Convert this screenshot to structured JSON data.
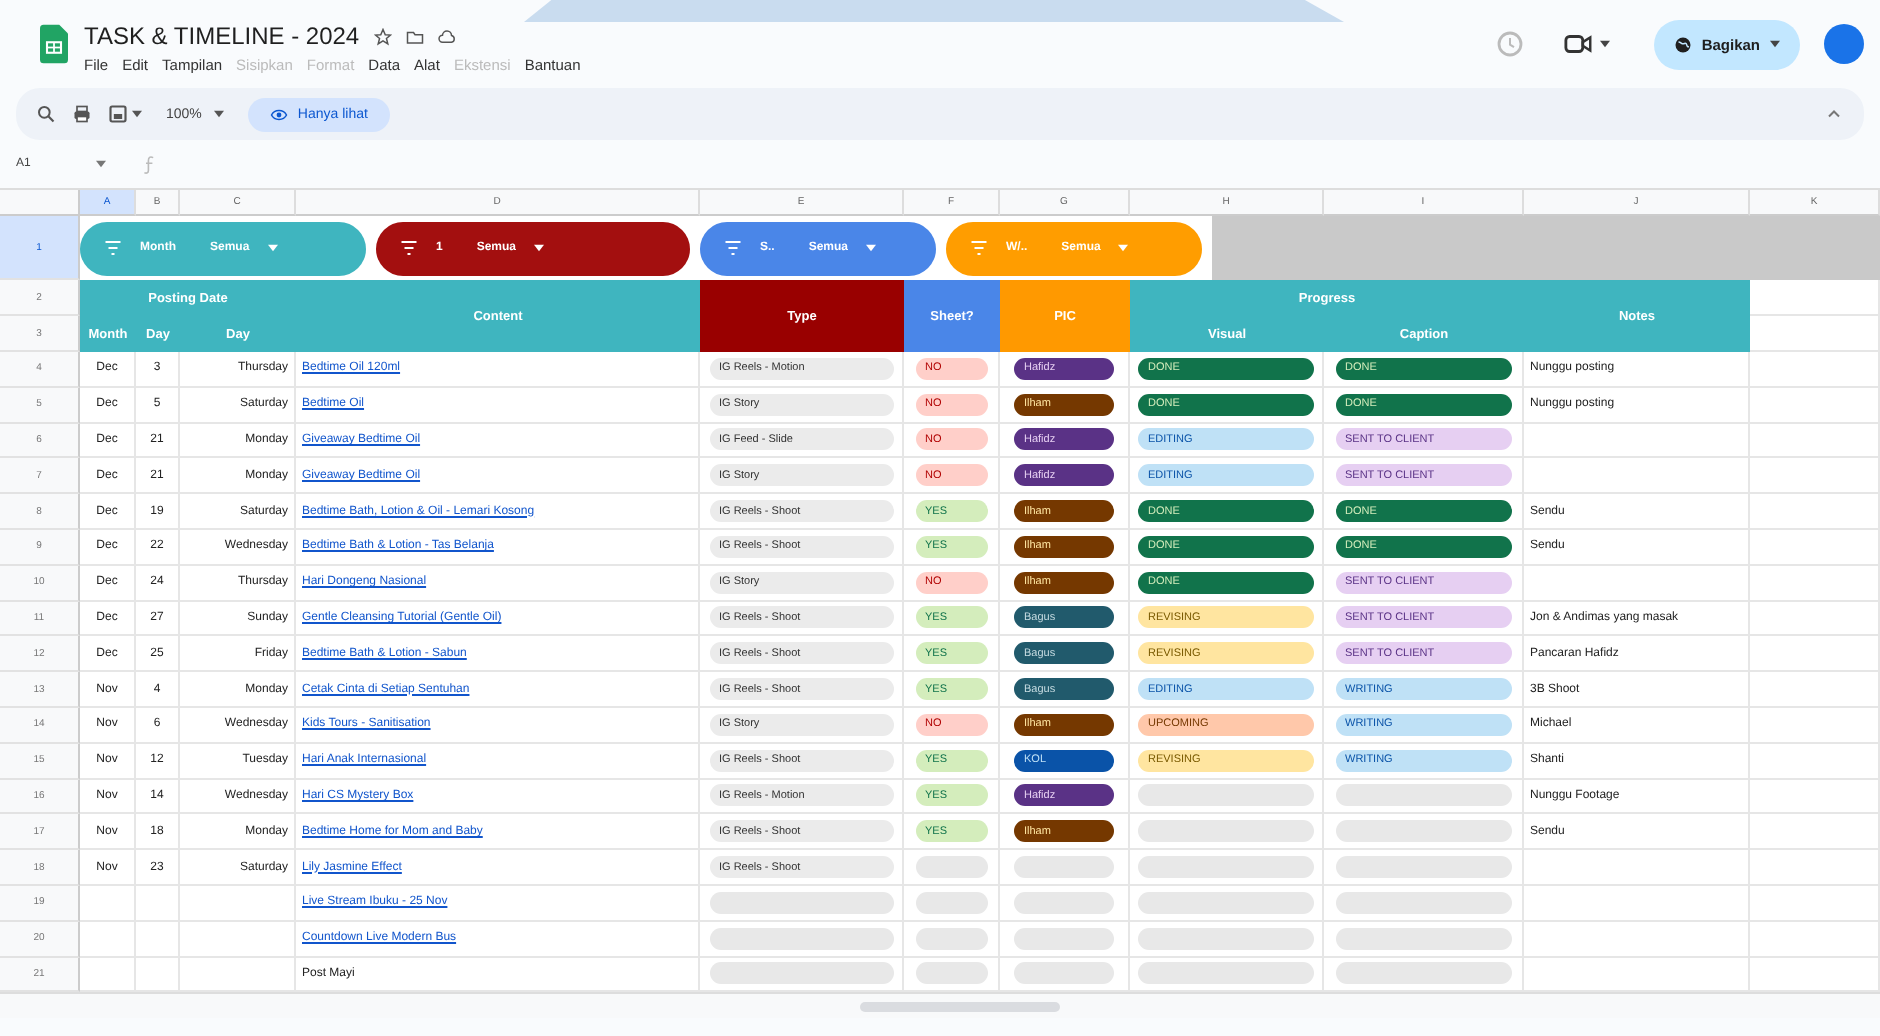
{
  "document": {
    "title": "TASK & TIMELINE - 2024"
  },
  "menu": [
    {
      "label": "File",
      "disabled": false
    },
    {
      "label": "Edit",
      "disabled": false
    },
    {
      "label": "Tampilan",
      "disabled": false
    },
    {
      "label": "Sisipkan",
      "disabled": true
    },
    {
      "label": "Format",
      "disabled": true
    },
    {
      "label": "Data",
      "disabled": false
    },
    {
      "label": "Alat",
      "disabled": false
    },
    {
      "label": "Ekstensi",
      "disabled": true
    },
    {
      "label": "Bantuan",
      "disabled": false
    }
  ],
  "share_button": {
    "label": "Bagikan"
  },
  "toolbar": {
    "zoom": "100%",
    "mode": "Hanya lihat"
  },
  "formula_bar": {
    "cell": "A1"
  },
  "columns": [
    {
      "letter": "A",
      "selected": true
    },
    {
      "letter": "B",
      "selected": false
    },
    {
      "letter": "C",
      "selected": false
    },
    {
      "letter": "D",
      "selected": false
    },
    {
      "letter": "E",
      "selected": false
    },
    {
      "letter": "F",
      "selected": false
    },
    {
      "letter": "G",
      "selected": false
    },
    {
      "letter": "H",
      "selected": false
    },
    {
      "letter": "I",
      "selected": false
    },
    {
      "letter": "J",
      "selected": false
    },
    {
      "letter": "K",
      "selected": false
    }
  ],
  "filters": [
    {
      "kind": "teal",
      "label": "Month",
      "value": "Semua"
    },
    {
      "kind": "red",
      "label": "1",
      "value": "Semua"
    },
    {
      "kind": "blue",
      "label": "S..",
      "value": "Semua"
    },
    {
      "kind": "orange",
      "label": "W/..",
      "value": "Semua"
    }
  ],
  "header": {
    "row_numbers": [
      "1",
      "2",
      "3"
    ],
    "posting_date": "Posting Date",
    "month": "Month",
    "day": "Day",
    "weekday": "Day",
    "content": "Content",
    "type": "Type",
    "sheet": "Sheet?",
    "pic": "PIC",
    "progress": "Progress",
    "visual": "Visual",
    "caption": "Caption",
    "notes": "Notes"
  },
  "rows": [
    {
      "n": "4",
      "month": "Dec",
      "day": "3",
      "weekday": "Thursday",
      "content": "Bedtime Oil 120ml",
      "link": true,
      "type": {
        "kind": "tag",
        "label": "IG Reels - Motion"
      },
      "sheet": {
        "kind": "no",
        "label": "NO"
      },
      "pic": {
        "kind": "hafidz",
        "label": "Hafidz"
      },
      "visual": {
        "kind": "done",
        "label": "DONE"
      },
      "caption": {
        "kind": "done",
        "label": "DONE"
      },
      "notes": "Nunggu posting"
    },
    {
      "n": "5",
      "month": "Dec",
      "day": "5",
      "weekday": "Saturday",
      "content": "Bedtime Oil",
      "link": true,
      "type": {
        "kind": "tag",
        "label": "IG Story"
      },
      "sheet": {
        "kind": "no",
        "label": "NO"
      },
      "pic": {
        "kind": "ilham",
        "label": "Ilham"
      },
      "visual": {
        "kind": "done",
        "label": "DONE"
      },
      "caption": {
        "kind": "done",
        "label": "DONE"
      },
      "notes": "Nunggu posting"
    },
    {
      "n": "6",
      "month": "Dec",
      "day": "21",
      "weekday": "Monday",
      "content": "Giveaway Bedtime Oil",
      "link": true,
      "type": {
        "kind": "tag",
        "label": "IG Feed - Slide"
      },
      "sheet": {
        "kind": "no",
        "label": "NO"
      },
      "pic": {
        "kind": "hafidz",
        "label": "Hafidz"
      },
      "visual": {
        "kind": "editing",
        "label": "EDITING"
      },
      "caption": {
        "kind": "sent",
        "label": "SENT TO CLIENT"
      }
    },
    {
      "n": "7",
      "month": "Dec",
      "day": "21",
      "weekday": "Monday",
      "content": "Giveaway Bedtime Oil",
      "link": true,
      "type": {
        "kind": "tag",
        "label": "IG Story"
      },
      "sheet": {
        "kind": "no",
        "label": "NO"
      },
      "pic": {
        "kind": "hafidz",
        "label": "Hafidz"
      },
      "visual": {
        "kind": "editing",
        "label": "EDITING"
      },
      "caption": {
        "kind": "sent",
        "label": "SENT TO CLIENT"
      }
    },
    {
      "n": "8",
      "month": "Dec",
      "day": "19",
      "weekday": "Saturday",
      "content": "Bedtime Bath, Lotion & Oil - Lemari Kosong",
      "link": true,
      "type": {
        "kind": "tag",
        "label": "IG Reels - Shoot"
      },
      "sheet": {
        "kind": "yes",
        "label": "YES"
      },
      "pic": {
        "kind": "ilham",
        "label": "Ilham"
      },
      "visual": {
        "kind": "done",
        "label": "DONE"
      },
      "caption": {
        "kind": "done",
        "label": "DONE"
      },
      "notes": "Sendu"
    },
    {
      "n": "9",
      "month": "Dec",
      "day": "22",
      "weekday": "Wednesday",
      "content": "Bedtime Bath & Lotion - Tas Belanja",
      "link": true,
      "type": {
        "kind": "tag",
        "label": "IG Reels - Shoot"
      },
      "sheet": {
        "kind": "yes",
        "label": "YES"
      },
      "pic": {
        "kind": "ilham",
        "label": "Ilham"
      },
      "visual": {
        "kind": "done",
        "label": "DONE"
      },
      "caption": {
        "kind": "done",
        "label": "DONE"
      },
      "notes": "Sendu"
    },
    {
      "n": "10",
      "month": "Dec",
      "day": "24",
      "weekday": "Thursday",
      "content": "Hari Dongeng Nasional",
      "link": true,
      "type": {
        "kind": "tag",
        "label": "IG Story"
      },
      "sheet": {
        "kind": "no",
        "label": "NO"
      },
      "pic": {
        "kind": "ilham",
        "label": "Ilham"
      },
      "visual": {
        "kind": "done",
        "label": "DONE"
      },
      "caption": {
        "kind": "sent",
        "label": "SENT TO CLIENT"
      }
    },
    {
      "n": "11",
      "month": "Dec",
      "day": "27",
      "weekday": "Sunday",
      "content": "Gentle Cleansing Tutorial (Gentle Oil)",
      "link": true,
      "type": {
        "kind": "tag",
        "label": "IG Reels - Shoot"
      },
      "sheet": {
        "kind": "yes",
        "label": "YES"
      },
      "pic": {
        "kind": "bagus",
        "label": "Bagus"
      },
      "visual": {
        "kind": "revising",
        "label": "REVISING"
      },
      "caption": {
        "kind": "sent",
        "label": "SENT TO CLIENT"
      },
      "notes": "Jon & Andimas yang masak"
    },
    {
      "n": "12",
      "month": "Dec",
      "day": "25",
      "weekday": "Friday",
      "content": "Bedtime Bath & Lotion - Sabun",
      "link": true,
      "type": {
        "kind": "tag",
        "label": "IG Reels - Shoot"
      },
      "sheet": {
        "kind": "yes",
        "label": "YES"
      },
      "pic": {
        "kind": "bagus",
        "label": "Bagus"
      },
      "visual": {
        "kind": "revising",
        "label": "REVISING"
      },
      "caption": {
        "kind": "sent",
        "label": "SENT TO CLIENT"
      },
      "notes": "Pancaran Hafidz"
    },
    {
      "n": "13",
      "month": "Nov",
      "day": "4",
      "weekday": "Monday",
      "content": "Cetak Cinta di Setiap Sentuhan",
      "link": true,
      "type": {
        "kind": "tag",
        "label": "IG Reels - Shoot"
      },
      "sheet": {
        "kind": "yes",
        "label": "YES"
      },
      "pic": {
        "kind": "bagus",
        "label": "Bagus"
      },
      "visual": {
        "kind": "editing",
        "label": "EDITING"
      },
      "caption": {
        "kind": "writing",
        "label": "WRITING"
      },
      "notes": "3B Shoot"
    },
    {
      "n": "14",
      "month": "Nov",
      "day": "6",
      "weekday": "Wednesday",
      "content": "Kids Tours - Sanitisation",
      "link": true,
      "type": {
        "kind": "tag",
        "label": "IG Story"
      },
      "sheet": {
        "kind": "no",
        "label": "NO"
      },
      "pic": {
        "kind": "ilham",
        "label": "Ilham"
      },
      "visual": {
        "kind": "upcoming",
        "label": "UPCOMING"
      },
      "caption": {
        "kind": "writing",
        "label": "WRITING"
      },
      "notes": "Michael"
    },
    {
      "n": "15",
      "month": "Nov",
      "day": "12",
      "weekday": "Tuesday",
      "content": "Hari Anak Internasional",
      "link": true,
      "type": {
        "kind": "tag",
        "label": "IG Reels - Shoot"
      },
      "sheet": {
        "kind": "yes",
        "label": "YES"
      },
      "pic": {
        "kind": "kol",
        "label": "KOL"
      },
      "visual": {
        "kind": "revising",
        "label": "REVISING"
      },
      "caption": {
        "kind": "writing",
        "label": "WRITING"
      },
      "notes": "Shanti"
    },
    {
      "n": "16",
      "month": "Nov",
      "day": "14",
      "weekday": "Wednesday",
      "content": "Hari CS Mystery Box",
      "link": true,
      "type": {
        "kind": "tag",
        "label": "IG Reels - Motion"
      },
      "sheet": {
        "kind": "yes",
        "label": "YES"
      },
      "pic": {
        "kind": "hafidz",
        "label": "Hafidz"
      },
      "visual": {
        "kind": "empty"
      },
      "caption": {
        "kind": "empty"
      },
      "notes": "Nunggu Footage"
    },
    {
      "n": "17",
      "month": "Nov",
      "day": "18",
      "weekday": "Monday",
      "content": "Bedtime Home for Mom and Baby",
      "link": true,
      "type": {
        "kind": "tag",
        "label": "IG Reels - Shoot"
      },
      "sheet": {
        "kind": "yes",
        "label": "YES"
      },
      "pic": {
        "kind": "ilham",
        "label": "Ilham"
      },
      "visual": {
        "kind": "empty"
      },
      "caption": {
        "kind": "empty"
      },
      "notes": "Sendu"
    },
    {
      "n": "18",
      "month": "Nov",
      "day": "23",
      "weekday": "Saturday",
      "content": "Lily Jasmine Effect",
      "link": true,
      "type": {
        "kind": "tag",
        "label": "IG Reels - Shoot"
      },
      "sheet": {
        "kind": "empty"
      },
      "pic": {
        "kind": "empty"
      },
      "visual": {
        "kind": "empty"
      },
      "caption": {
        "kind": "empty"
      }
    },
    {
      "n": "19",
      "content": "Live Stream Ibuku - 25 Nov",
      "link": true,
      "type": {
        "kind": "empty"
      },
      "sheet": {
        "kind": "empty"
      },
      "pic": {
        "kind": "empty"
      },
      "visual": {
        "kind": "empty"
      },
      "caption": {
        "kind": "empty"
      }
    },
    {
      "n": "20",
      "content": "Countdown Live Modern Bus",
      "link": true,
      "type": {
        "kind": "empty"
      },
      "sheet": {
        "kind": "empty"
      },
      "pic": {
        "kind": "empty"
      },
      "visual": {
        "kind": "empty"
      },
      "caption": {
        "kind": "empty"
      }
    },
    {
      "n": "21",
      "content": "Post Mayi",
      "link": false,
      "type": {
        "kind": "empty"
      },
      "sheet": {
        "kind": "empty"
      },
      "pic": {
        "kind": "empty"
      },
      "visual": {
        "kind": "empty"
      },
      "caption": {
        "kind": "empty"
      }
    }
  ]
}
